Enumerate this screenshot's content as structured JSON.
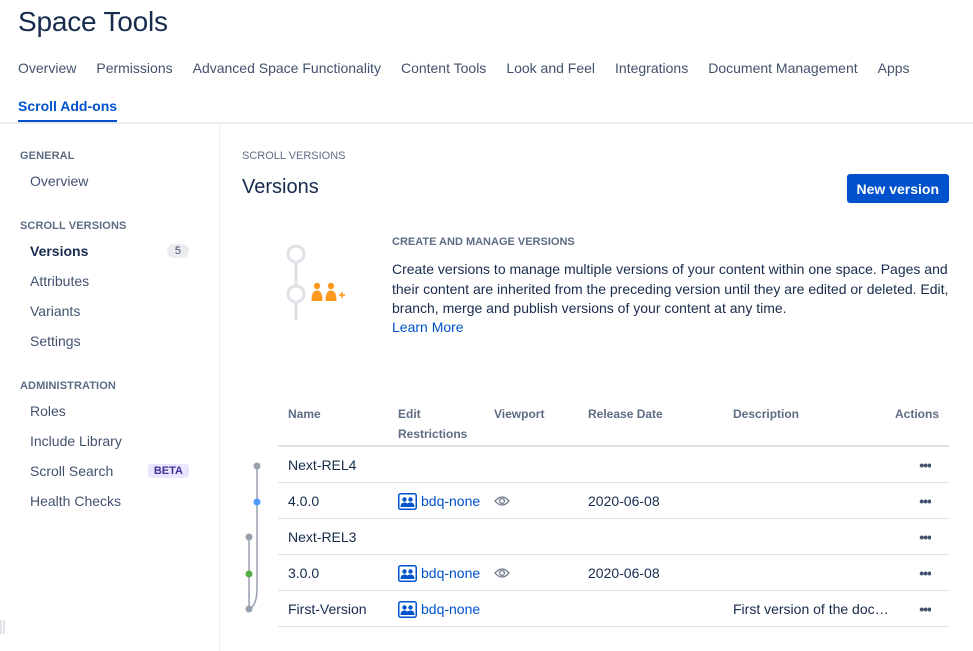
{
  "page": {
    "title": "Space Tools"
  },
  "nav": {
    "row1": [
      "Overview",
      "Permissions",
      "Advanced Space Functionality",
      "Content Tools",
      "Look and Feel",
      "Integrations",
      "Document Management",
      "Apps"
    ],
    "row2": [
      "Scroll Add-ons"
    ],
    "active": "Scroll Add-ons"
  },
  "sidebar": {
    "general": {
      "heading": "GENERAL",
      "items": [
        "Overview"
      ]
    },
    "scroll_versions": {
      "heading": "SCROLL VERSIONS",
      "versions_label": "Versions",
      "versions_count": "5",
      "items": [
        "Attributes",
        "Variants",
        "Settings"
      ]
    },
    "administration": {
      "heading": "ADMINISTRATION",
      "roles": "Roles",
      "include_library": "Include Library",
      "scroll_search": "Scroll Search",
      "beta": "BETA",
      "health_checks": "Health Checks"
    }
  },
  "main": {
    "breadcrumb": "SCROLL VERSIONS",
    "title": "Versions",
    "new_version_button": "New version",
    "intro": {
      "heading": "CREATE AND MANAGE VERSIONS",
      "text": "Create versions to manage multiple versions of your content within one space. Pages and their content are inherited from the preceding version until they are edited or deleted. Edit, branch, merge and publish versions of your content at any time.",
      "link": "Learn More"
    }
  },
  "table": {
    "headers": {
      "name": "Name",
      "edit_line1": "Edit",
      "edit_line2": "Restrictions",
      "viewport": "Viewport",
      "release_date": "Release Date",
      "description": "Description",
      "actions": "Actions"
    },
    "action_glyph": "•••",
    "rows": [
      {
        "name": "Next-REL4",
        "restriction": "",
        "viewport": false,
        "release_date": "",
        "description": ""
      },
      {
        "name": "4.0.0",
        "restriction": "bdq-none",
        "viewport": true,
        "release_date": "2020-06-08",
        "description": ""
      },
      {
        "name": "Next-REL3",
        "restriction": "",
        "viewport": false,
        "release_date": "",
        "description": ""
      },
      {
        "name": "3.0.0",
        "restriction": "bdq-none",
        "viewport": true,
        "release_date": "2020-06-08",
        "description": ""
      },
      {
        "name": "First-Version",
        "restriction": "bdq-none",
        "viewport": false,
        "release_date": "",
        "description": "First version of the doc…"
      }
    ]
  },
  "colors": {
    "primary": "#0052cc",
    "illustration_orange": "#ff991f",
    "tree_blue": "#4c9aff",
    "tree_green": "#5aac44",
    "tree_gray": "#97a0af"
  }
}
